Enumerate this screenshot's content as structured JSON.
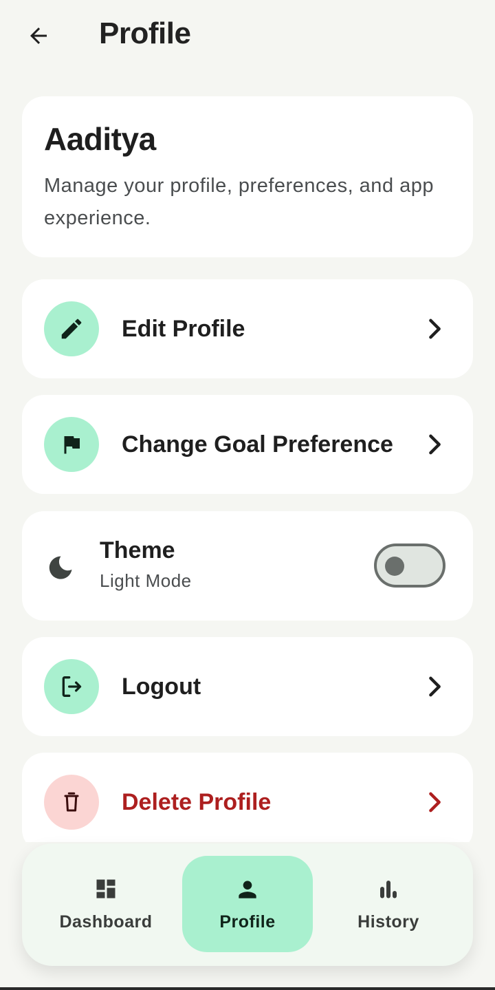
{
  "header": {
    "title": "Profile",
    "back_icon": "arrow-left-icon"
  },
  "profile_card": {
    "name": "Aaditya",
    "description": "Manage your profile, preferences, and app experience."
  },
  "menu": {
    "edit_profile": {
      "label": "Edit Profile",
      "icon": "pencil-icon"
    },
    "change_goal": {
      "label": "Change Goal Preference",
      "icon": "flag-icon"
    },
    "theme": {
      "title": "Theme",
      "subtitle": "Light Mode",
      "icon": "moon-icon",
      "enabled": false
    },
    "logout": {
      "label": "Logout",
      "icon": "logout-icon"
    },
    "delete_profile": {
      "label": "Delete Profile",
      "icon": "trash-icon"
    }
  },
  "bottom_nav": {
    "items": [
      {
        "label": "Dashboard",
        "icon": "dashboard-icon"
      },
      {
        "label": "Profile",
        "icon": "person-icon",
        "active": true
      },
      {
        "label": "History",
        "icon": "bar-chart-icon"
      }
    ]
  },
  "colors": {
    "background": "#f5f6f2",
    "card": "#ffffff",
    "accent": "#a9f0cf",
    "danger": "#ad1f1f",
    "danger_tint": "#fbd5d3",
    "nav_background": "#f1f8f1"
  }
}
